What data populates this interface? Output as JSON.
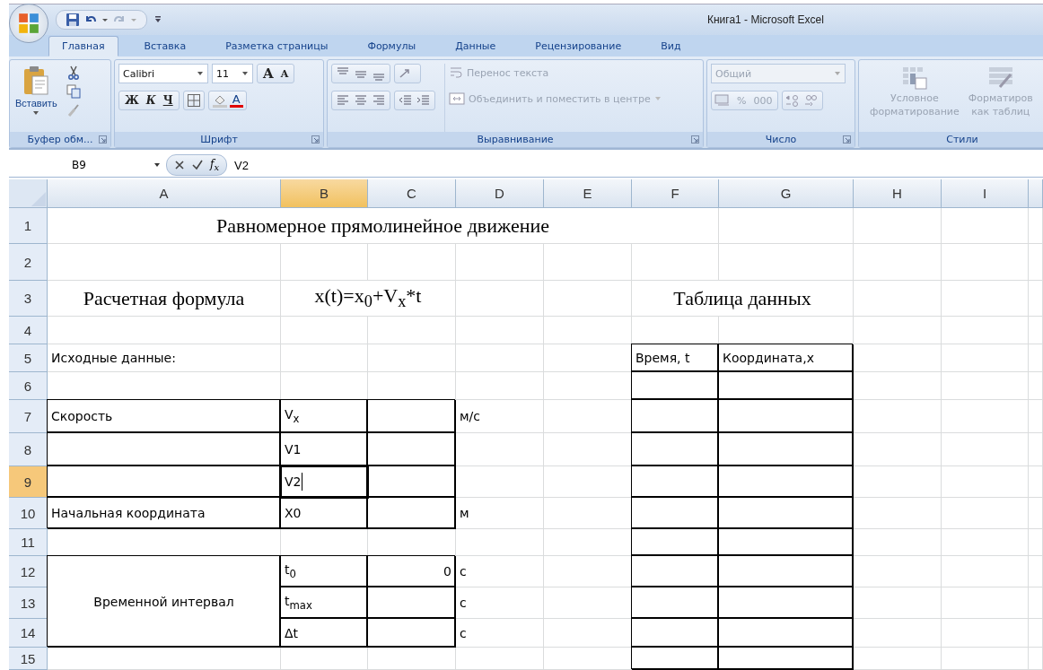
{
  "window": {
    "title": "Книга1 - Microsoft Excel"
  },
  "tabs": [
    {
      "label": "Главная",
      "selected": true
    },
    {
      "label": "Вставка",
      "selected": false
    },
    {
      "label": "Разметка страницы",
      "selected": false
    },
    {
      "label": "Формулы",
      "selected": false
    },
    {
      "label": "Данные",
      "selected": false
    },
    {
      "label": "Рецензирование",
      "selected": false
    },
    {
      "label": "Вид",
      "selected": false
    }
  ],
  "ribbon": {
    "clipboard": {
      "paste_label": "Вставить",
      "group_label": "Буфер обм..."
    },
    "font": {
      "font_name": "Calibri",
      "font_size": "11",
      "grow": "A",
      "shrink": "A",
      "bold": "Ж",
      "italic": "К",
      "underline": "Ч",
      "color_letter": "A",
      "group_label": "Шрифт"
    },
    "alignment": {
      "wrap_label": "Перенос текста",
      "merge_label": "Объединить и поместить в центре",
      "disabled": true,
      "group_label": "Выравнивание"
    },
    "number": {
      "format": "Общий",
      "percent": "%",
      "thousands": "000",
      "disabled": true,
      "group_label": "Число"
    },
    "styles": {
      "conditional_lines": [
        "Условное",
        "форматирование"
      ],
      "table_lines": [
        "Форматиров",
        "как таблиц"
      ],
      "disabled": true,
      "group_label": "Стили"
    }
  },
  "formula_bar": {
    "name_box": "B9",
    "function_label": "f$_{x}$",
    "value": "V2"
  },
  "sheet": {
    "columns": [
      {
        "label": "A",
        "selected": false
      },
      {
        "label": "B",
        "selected": true
      },
      {
        "label": "C",
        "selected": false
      },
      {
        "label": "D",
        "selected": false
      },
      {
        "label": "E",
        "selected": false
      },
      {
        "label": "F",
        "selected": false
      },
      {
        "label": "G",
        "selected": false
      },
      {
        "label": "H",
        "selected": false
      },
      {
        "label": "I",
        "selected": false
      }
    ],
    "rows": [
      {
        "number": "1",
        "selected": false,
        "cells": [
          {
            "kind": "title",
            "text": "Равномерное прямолинейное движение",
            "bordered": false,
            "selected": false
          }
        ]
      },
      {
        "number": "2",
        "selected": false
      },
      {
        "number": "3",
        "selected": false,
        "cells": [
          {
            "kind": "heading",
            "text": "Расчетная формула",
            "bordered": false,
            "selected": false
          },
          {
            "kind": "formula",
            "text": "x(t)=x$_{0}$+V$_{x}$*t",
            "bordered": false,
            "selected": false
          },
          {
            "bordered": false,
            "selected": false
          },
          {
            "bordered": false,
            "selected": false
          },
          {
            "kind": "table_title",
            "text": "Таблица данных",
            "bordered": false,
            "selected": false
          }
        ]
      },
      {
        "number": "4",
        "selected": false
      },
      {
        "number": "5",
        "selected": false,
        "cells": [
          {
            "text": "Исходные данные:",
            "bordered": false,
            "selected": false
          },
          {
            "bordered": false,
            "selected": false
          },
          {
            "bordered": false,
            "selected": false
          },
          {
            "bordered": false,
            "selected": false
          },
          {
            "bordered": false,
            "selected": false
          },
          {
            "text": "Время, t",
            "bordered": true,
            "selected": false
          },
          {
            "text": "Координата,x",
            "bordered": true,
            "selected": false
          }
        ]
      },
      {
        "number": "6",
        "selected": false,
        "cells": [
          {
            "bordered": false,
            "selected": false
          },
          {
            "bordered": false,
            "selected": false
          },
          {
            "bordered": false,
            "selected": false
          },
          {
            "bordered": false,
            "selected": false
          },
          {
            "bordered": false,
            "selected": false
          },
          {
            "bordered": true,
            "selected": false
          },
          {
            "bordered": true,
            "selected": false
          }
        ]
      },
      {
        "number": "7",
        "selected": false,
        "cells": [
          {
            "text": "Скорость",
            "bordered": true,
            "selected": false
          },
          {
            "text": "V$_{x}$",
            "bordered": true,
            "selected": false
          },
          {
            "bordered": true,
            "selected": false
          },
          {
            "text": "м/с",
            "bordered": false,
            "selected": false
          },
          {
            "bordered": false,
            "selected": false
          },
          {
            "bordered": true,
            "selected": false
          },
          {
            "bordered": true,
            "selected": false
          }
        ]
      },
      {
        "number": "8",
        "selected": false,
        "cells": [
          {
            "bordered": true,
            "selected": false
          },
          {
            "text": "V1",
            "bordered": true,
            "selected": false
          },
          {
            "bordered": true,
            "selected": false
          },
          {
            "bordered": false,
            "selected": false
          },
          {
            "bordered": false,
            "selected": false
          },
          {
            "bordered": true,
            "selected": false
          },
          {
            "bordered": true,
            "selected": false
          }
        ]
      },
      {
        "number": "9",
        "selected": true,
        "cells": [
          {
            "bordered": true,
            "selected": false
          },
          {
            "text": "V2",
            "bordered": true,
            "selected": true
          },
          {
            "bordered": true,
            "selected": false
          },
          {
            "bordered": false,
            "selected": false
          },
          {
            "bordered": false,
            "selected": false
          },
          {
            "bordered": true,
            "selected": false
          },
          {
            "bordered": true,
            "selected": false
          }
        ]
      },
      {
        "number": "10",
        "selected": false,
        "cells": [
          {
            "text": "Начальная координата",
            "bordered": true,
            "selected": false
          },
          {
            "text": "X0",
            "bordered": true,
            "selected": false
          },
          {
            "bordered": true,
            "selected": false
          },
          {
            "text": "м",
            "bordered": false,
            "selected": false
          },
          {
            "bordered": false,
            "selected": false
          },
          {
            "bordered": true,
            "selected": false
          },
          {
            "bordered": true,
            "selected": false
          }
        ]
      },
      {
        "number": "11",
        "selected": false,
        "cells": [
          {
            "bordered": false,
            "selected": false
          },
          {
            "bordered": false,
            "selected": false
          },
          {
            "bordered": false,
            "selected": false
          },
          {
            "bordered": false,
            "selected": false
          },
          {
            "bordered": false,
            "selected": false
          },
          {
            "bordered": true,
            "selected": false
          },
          {
            "bordered": true,
            "selected": false
          }
        ]
      },
      {
        "number": "12",
        "selected": false,
        "cells": [
          {
            "kind": "merged_label",
            "text": "Временной интервал",
            "bordered": true,
            "selected": false
          },
          {
            "text": "t$_{0}$",
            "bordered": true,
            "selected": false
          },
          {
            "kind": "number",
            "text": "0",
            "bordered": true,
            "selected": false
          },
          {
            "text": "с",
            "bordered": false,
            "selected": false
          },
          {
            "bordered": false,
            "selected": false
          },
          {
            "bordered": true,
            "selected": false
          },
          {
            "bordered": true,
            "selected": false
          }
        ]
      },
      {
        "number": "13",
        "selected": false,
        "cells": [
          {
            "text": "t$_{max}$",
            "bordered": true,
            "selected": false
          },
          {
            "bordered": true,
            "selected": false
          },
          {
            "text": "с",
            "bordered": false,
            "selected": false
          },
          {
            "bordered": false,
            "selected": false
          },
          {
            "bordered": true,
            "selected": false
          },
          {
            "bordered": true,
            "selected": false
          }
        ]
      },
      {
        "number": "14",
        "selected": false,
        "cells": [
          {
            "text": "Δt",
            "bordered": true,
            "selected": false
          },
          {
            "bordered": true,
            "selected": false
          },
          {
            "text": "с",
            "bordered": false,
            "selected": false
          },
          {
            "bordered": false,
            "selected": false
          },
          {
            "bordered": true,
            "selected": false
          },
          {
            "bordered": true,
            "selected": false
          }
        ]
      },
      {
        "number": "15",
        "selected": false,
        "cells": [
          {
            "bordered": false,
            "selected": false
          },
          {
            "bordered": false,
            "selected": false
          },
          {
            "bordered": false,
            "selected": false
          },
          {
            "bordered": false,
            "selected": false
          },
          {
            "bordered": false,
            "selected": false
          },
          {
            "bordered": true,
            "selected": false
          },
          {
            "bordered": true,
            "selected": false
          }
        ]
      }
    ]
  }
}
